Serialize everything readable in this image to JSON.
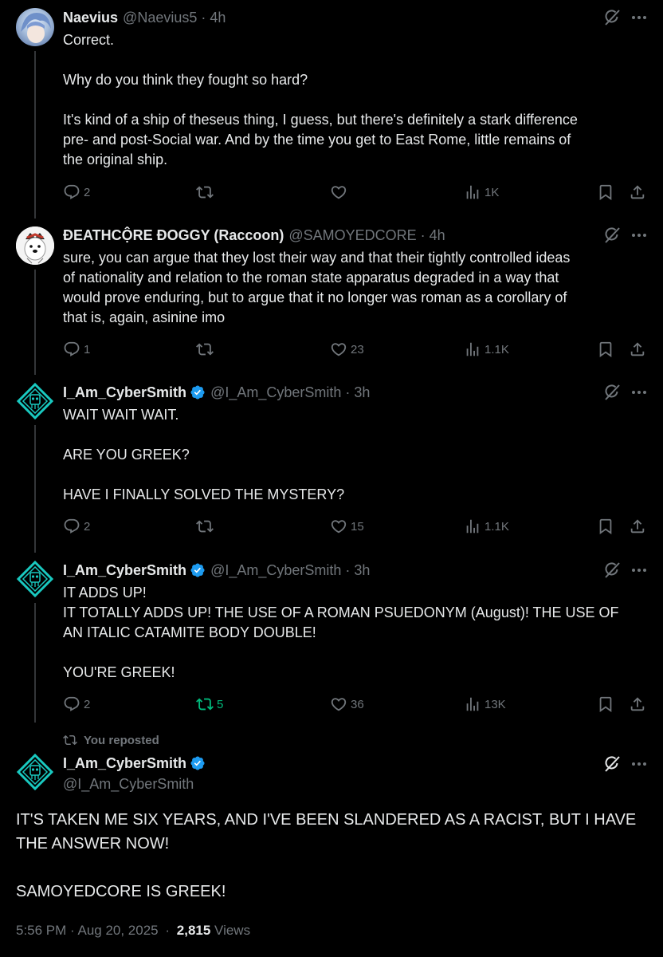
{
  "tweets": [
    {
      "name": "Naevius",
      "handle": "@Naevius5",
      "time": "4h",
      "body": "Correct.\n\nWhy do you think they fought so hard?\n\nIt's kind of a ship of theseus thing, I guess, but there's definitely a stark difference\npre- and post-Social war. And by the time you get to East Rome, little remains of\nthe original ship.",
      "replies": "2",
      "reposts": "",
      "likes": "",
      "views": "1K"
    },
    {
      "name": "ĐEATHCỘRE ĐOGGY (Raccoon)",
      "handle": "@SAMOYEDCORE",
      "time": "4h",
      "body": "sure, you can argue that they lost their way and that their tightly controlled ideas\nof nationality and relation to the roman state apparatus degraded in a way that\nwould prove enduring, but to argue that it no longer was roman as a corollary of\nthat is, again, asinine imo",
      "replies": "1",
      "reposts": "",
      "likes": "23",
      "views": "1.1K"
    },
    {
      "name": "I_Am_CyberSmith",
      "handle": "@I_Am_CyberSmith",
      "time": "3h",
      "body": "WAIT WAIT WAIT.\n\nARE YOU GREEK?\n\nHAVE I FINALLY SOLVED THE MYSTERY?",
      "replies": "2",
      "reposts": "",
      "likes": "15",
      "views": "1.1K"
    },
    {
      "name": "I_Am_CyberSmith",
      "handle": "@I_Am_CyberSmith",
      "time": "3h",
      "body": "IT ADDS UP!\nIT TOTALLY ADDS UP! THE USE OF A ROMAN PSUEDONYM (August)! THE USE OF\nAN ITALIC CATAMITE BODY DOUBLE!\n\nYOU'RE GREEK!",
      "replies": "2",
      "reposts": "5",
      "likes": "36",
      "views": "13K"
    }
  ],
  "main_tweet": {
    "repost_note": "You reposted",
    "name": "I_Am_CyberSmith",
    "handle": "@I_Am_CyberSmith",
    "body": "IT'S TAKEN ME SIX YEARS, AND I'VE BEEN SLANDERED AS A RACIST, BUT I HAVE\nTHE ANSWER NOW!\n\nSAMOYEDCORE IS GREEK!",
    "time": "5:56 PM · Aug 20, 2025",
    "sep": "·",
    "views_count": "2,815",
    "views_label": "Views"
  },
  "colors": {
    "accent": "#1d9bf0",
    "repost_active": "#00ba7c",
    "muted": "#71767b",
    "text": "#e7e9ea"
  },
  "icons": {
    "reply": "reply-icon",
    "repost": "repost-icon",
    "like": "heart-icon",
    "views": "views-icon",
    "bookmark": "bookmark-icon",
    "share": "share-icon",
    "grok": "grok-icon",
    "more": "more-icon",
    "verified": "verified-badge-icon"
  }
}
